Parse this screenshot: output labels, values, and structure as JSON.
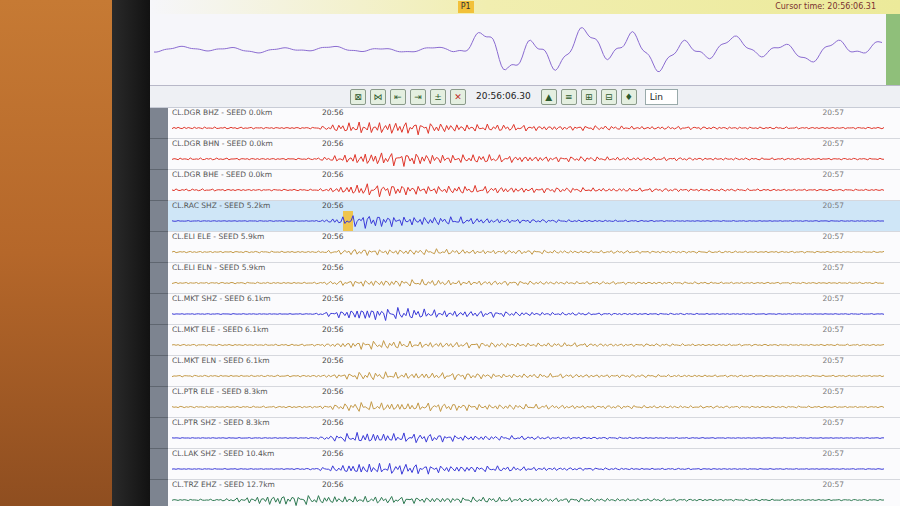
{
  "top_panel": {
    "header": "Cursor time: 20:56:06.31",
    "pick": "P1",
    "color": "#8a6ad0",
    "envelope": [
      0.12,
      0.1,
      0.12,
      0.1,
      0.12,
      0.1,
      0.12,
      0.95,
      0.9,
      0.8,
      0.85,
      0.6,
      0.45,
      0.4,
      0.5,
      0.35
    ]
  },
  "toolbar": {
    "left_buttons": [
      "⊠",
      "⋈",
      "⇤",
      "⇥",
      "±",
      "✕"
    ],
    "time": "20:56:06.30",
    "right_buttons": [
      "▲",
      "≡",
      "⊞",
      "⊟",
      "♦"
    ],
    "dropdown": "Lin"
  },
  "traces": [
    {
      "label": "CL.DGR BHZ - SEED 0.0km",
      "start": "20:56",
      "end": "20:57",
      "color": "#e0362a",
      "selected": false,
      "picked": false,
      "envelope": [
        0.15,
        0.12,
        0.1,
        0.1,
        0.95,
        0.8,
        0.6,
        0.45,
        0.35,
        0.3,
        0.25,
        0.2,
        0.15,
        0.12,
        0.1,
        0.1
      ]
    },
    {
      "label": "CL.DGR BHN - SEED 0.0km",
      "start": "20:56",
      "end": "20:57",
      "color": "#e0362a",
      "selected": false,
      "picked": false,
      "envelope": [
        0.15,
        0.12,
        0.1,
        0.1,
        0.9,
        0.85,
        0.65,
        0.5,
        0.4,
        0.3,
        0.25,
        0.2,
        0.15,
        0.12,
        0.1,
        0.1
      ]
    },
    {
      "label": "CL.DGR BHE - SEED 0.0km",
      "start": "20:56",
      "end": "20:57",
      "color": "#e0362a",
      "selected": false,
      "picked": false,
      "envelope": [
        0.15,
        0.12,
        0.1,
        0.1,
        0.85,
        0.7,
        0.55,
        0.45,
        0.35,
        0.3,
        0.25,
        0.2,
        0.15,
        0.12,
        0.1,
        0.1
      ]
    },
    {
      "label": "CL.RAC SHZ - SEED 5.2km",
      "start": "20:56",
      "end": "20:57",
      "color": "#3a3ad8",
      "selected": true,
      "picked": true,
      "envelope": [
        0.05,
        0.05,
        0.05,
        0.05,
        0.9,
        0.7,
        0.5,
        0.35,
        0.2,
        0.12,
        0.08,
        0.05,
        0.05,
        0.05,
        0.05,
        0.05
      ]
    },
    {
      "label": "CL.ELI ELE - SEED 5.9km",
      "start": "20:56",
      "end": "20:57",
      "color": "#c49a48",
      "selected": false,
      "picked": false,
      "envelope": [
        0.1,
        0.1,
        0.1,
        0.1,
        0.45,
        0.4,
        0.35,
        0.3,
        0.25,
        0.2,
        0.18,
        0.15,
        0.12,
        0.1,
        0.1,
        0.1
      ]
    },
    {
      "label": "CL.ELI ELN - SEED 5.9km",
      "start": "20:56",
      "end": "20:57",
      "color": "#c49a48",
      "selected": false,
      "picked": false,
      "envelope": [
        0.1,
        0.1,
        0.1,
        0.1,
        0.5,
        0.45,
        0.4,
        0.3,
        0.25,
        0.2,
        0.18,
        0.15,
        0.12,
        0.1,
        0.1,
        0.1
      ]
    },
    {
      "label": "CL.MKT SHZ - SEED 6.1km",
      "start": "20:56",
      "end": "20:57",
      "color": "#3a3ad8",
      "selected": false,
      "picked": false,
      "envelope": [
        0.05,
        0.05,
        0.05,
        0.05,
        0.95,
        0.75,
        0.5,
        0.35,
        0.25,
        0.15,
        0.1,
        0.08,
        0.06,
        0.05,
        0.05,
        0.05
      ]
    },
    {
      "label": "CL.MKT ELE - SEED 6.1km",
      "start": "20:56",
      "end": "20:57",
      "color": "#c49a48",
      "selected": false,
      "picked": false,
      "envelope": [
        0.1,
        0.1,
        0.1,
        0.12,
        0.6,
        0.5,
        0.4,
        0.35,
        0.3,
        0.25,
        0.2,
        0.15,
        0.12,
        0.1,
        0.1,
        0.1
      ]
    },
    {
      "label": "CL.MKT ELN - SEED 6.1km",
      "start": "20:56",
      "end": "20:57",
      "color": "#c49a48",
      "selected": false,
      "picked": false,
      "envelope": [
        0.1,
        0.1,
        0.1,
        0.12,
        0.55,
        0.5,
        0.45,
        0.35,
        0.3,
        0.25,
        0.2,
        0.15,
        0.12,
        0.1,
        0.1,
        0.1
      ]
    },
    {
      "label": "CL.PTR ELE - SEED 8.3km",
      "start": "20:56",
      "end": "20:57",
      "color": "#c49a48",
      "selected": false,
      "picked": false,
      "envelope": [
        0.1,
        0.1,
        0.1,
        0.15,
        0.65,
        0.6,
        0.5,
        0.4,
        0.3,
        0.25,
        0.2,
        0.18,
        0.15,
        0.12,
        0.1,
        0.1
      ]
    },
    {
      "label": "CL.PTR SHZ - SEED 8.3km",
      "start": "20:56",
      "end": "20:57",
      "color": "#3a3ad8",
      "selected": false,
      "picked": false,
      "envelope": [
        0.05,
        0.05,
        0.05,
        0.08,
        0.8,
        0.65,
        0.45,
        0.3,
        0.2,
        0.12,
        0.08,
        0.06,
        0.05,
        0.05,
        0.05,
        0.05
      ]
    },
    {
      "label": "CL.LAK SHZ - SEED 10.4km",
      "start": "20:56",
      "end": "20:57",
      "color": "#3a3ad8",
      "selected": false,
      "picked": false,
      "envelope": [
        0.05,
        0.05,
        0.05,
        0.1,
        0.85,
        0.7,
        0.5,
        0.35,
        0.25,
        0.15,
        0.1,
        0.08,
        0.06,
        0.05,
        0.05,
        0.05
      ]
    },
    {
      "label": "CL.TRZ EHZ - SEED 12.7km",
      "start": "20:56",
      "end": "20:57",
      "color": "#2e7a52",
      "selected": false,
      "picked": false,
      "envelope": [
        0.08,
        0.1,
        0.7,
        0.6,
        0.5,
        0.45,
        0.4,
        0.35,
        0.3,
        0.25,
        0.2,
        0.15,
        0.12,
        0.1,
        0.08,
        0.08
      ]
    }
  ]
}
